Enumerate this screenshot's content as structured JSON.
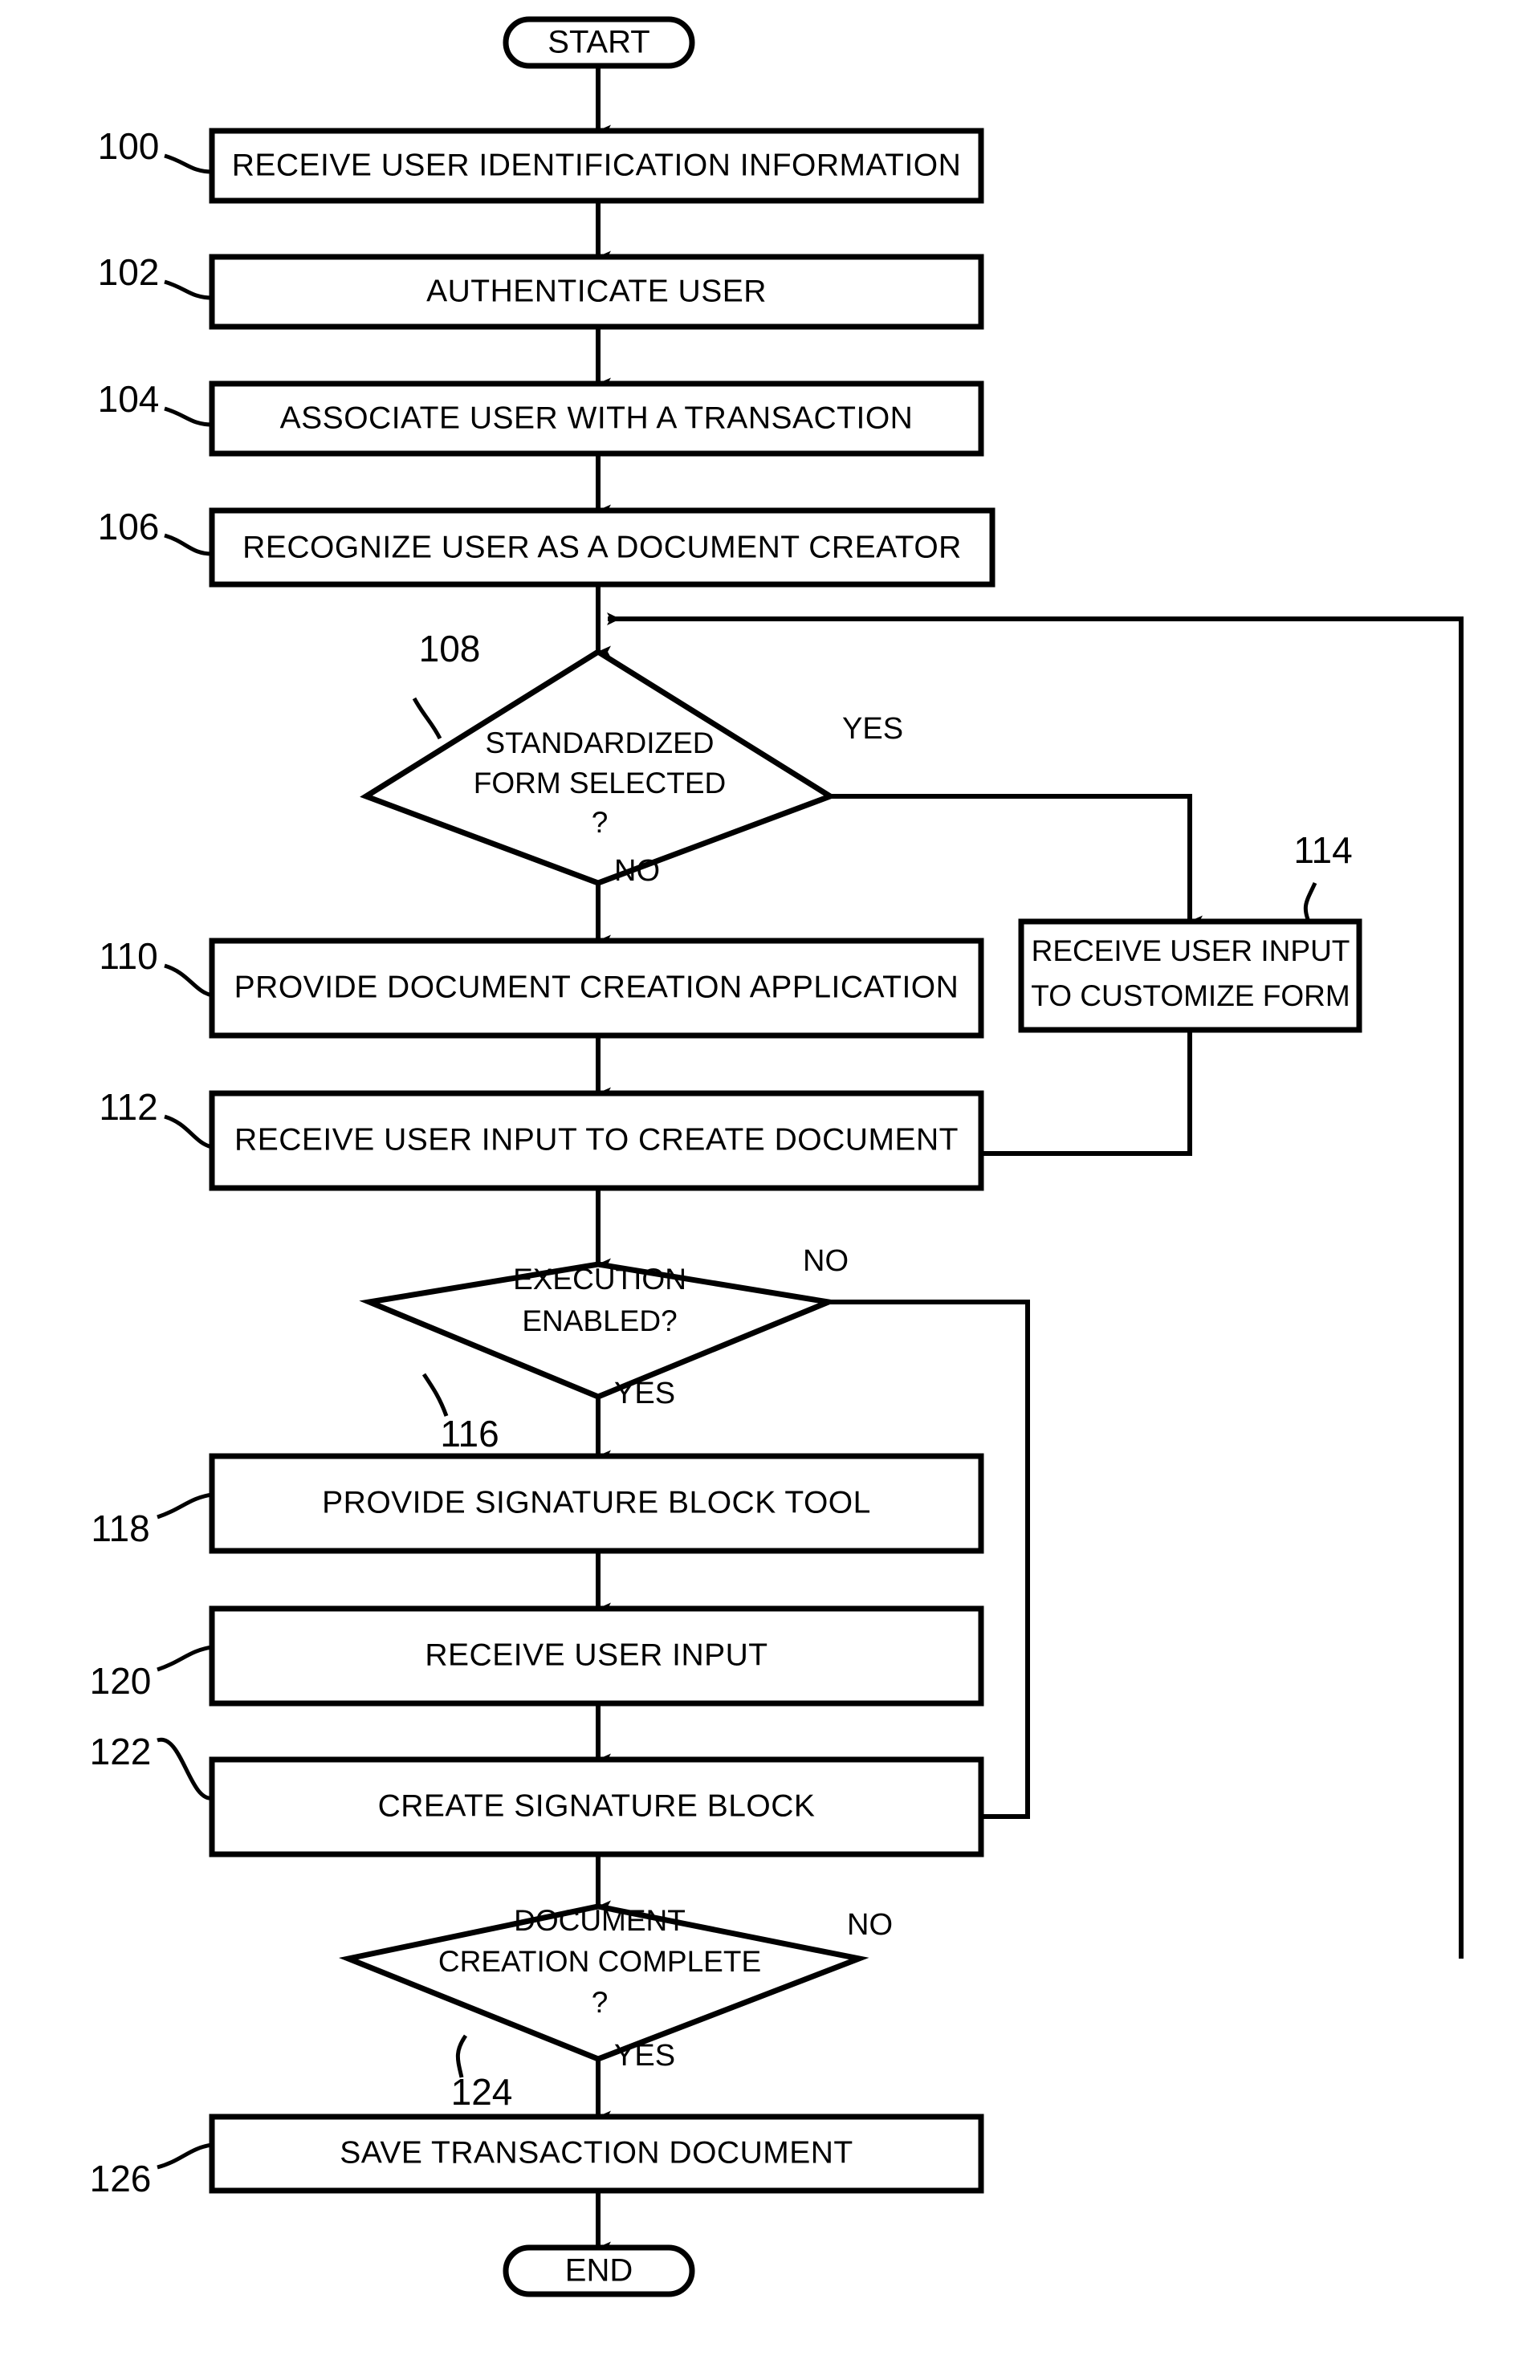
{
  "figure": {
    "type": "flowchart",
    "orientation": "vertical",
    "background_color": "#ffffff",
    "line_color": "#000000"
  },
  "terminals": {
    "start": "START",
    "end": "END"
  },
  "nodes": [
    {
      "ref": "100",
      "shape": "process",
      "label": "RECEIVE USER IDENTIFICATION INFORMATION"
    },
    {
      "ref": "102",
      "shape": "process",
      "label": "AUTHENTICATE USER"
    },
    {
      "ref": "104",
      "shape": "process",
      "label": "ASSOCIATE USER WITH A TRANSACTION"
    },
    {
      "ref": "106",
      "shape": "process",
      "label": "RECOGNIZE USER AS A DOCUMENT CREATOR"
    },
    {
      "ref": "108",
      "shape": "decision",
      "label_line1": "STANDARDIZED",
      "label_line2": "FORM SELECTED",
      "label_line3": "?"
    },
    {
      "ref": "110",
      "shape": "process",
      "label": "PROVIDE DOCUMENT CREATION APPLICATION"
    },
    {
      "ref": "112",
      "shape": "process",
      "label": "RECEIVE USER INPUT TO CREATE DOCUMENT"
    },
    {
      "ref": "114",
      "shape": "process",
      "label_line1": "RECEIVE USER INPUT",
      "label_line2": "TO CUSTOMIZE FORM"
    },
    {
      "ref": "116",
      "shape": "decision",
      "label_line1": "EXECUTION",
      "label_line2": "ENABLED?"
    },
    {
      "ref": "118",
      "shape": "process",
      "label": "PROVIDE SIGNATURE BLOCK TOOL"
    },
    {
      "ref": "120",
      "shape": "process",
      "label": "RECEIVE USER INPUT"
    },
    {
      "ref": "122",
      "shape": "process",
      "label": "CREATE SIGNATURE BLOCK"
    },
    {
      "ref": "124",
      "shape": "decision",
      "label_line1": "DOCUMENT",
      "label_line2": "CREATION COMPLETE",
      "label_line3": "?"
    },
    {
      "ref": "126",
      "shape": "process",
      "label": "SAVE TRANSACTION DOCUMENT"
    }
  ],
  "edge_labels": {
    "d108_yes": "YES",
    "d108_no": "NO",
    "d116_no": "NO",
    "d116_yes": "YES",
    "d124_no": "NO",
    "d124_yes": "YES"
  },
  "refs": {
    "r100": "100",
    "r102": "102",
    "r104": "104",
    "r106": "106",
    "r108": "108",
    "r110": "110",
    "r112": "112",
    "r114": "114",
    "r116": "116",
    "r118": "118",
    "r120": "120",
    "r122": "122",
    "r124": "124",
    "r126": "126"
  }
}
